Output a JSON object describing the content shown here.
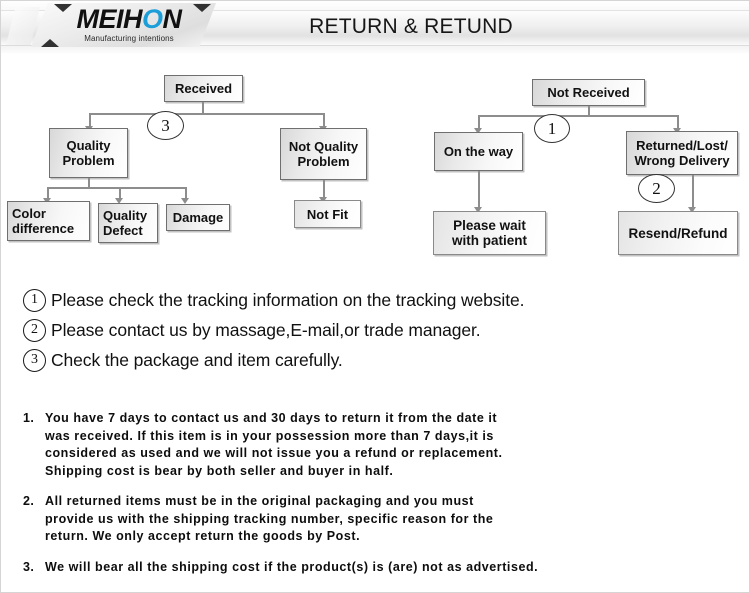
{
  "header": {
    "logo_text_main": "MEIH",
    "logo_text_accent": "O",
    "logo_text_tail": "N",
    "logo_tagline": "Manufacturing intentions",
    "title": "RETURN & RETUND",
    "accent_color": "#1c9fd8"
  },
  "flowchart_left": {
    "root": "Received",
    "branch_quality": "Quality\nProblem",
    "branch_quality_line1": "Quality",
    "branch_quality_line2": "Problem",
    "branch_not_quality_line1": "Not Quality",
    "branch_not_quality_line2": "Problem",
    "marker": "3",
    "leaf_color_line1": "Color",
    "leaf_color_line2": "difference",
    "leaf_defect_line1": "Quality",
    "leaf_defect_line2": "Defect",
    "leaf_damage": "Damage",
    "leaf_not_fit": "Not Fit"
  },
  "flowchart_right": {
    "root": "Not  Received",
    "marker_one": "1",
    "marker_two": "2",
    "branch_on_the_way": "On the way",
    "wait_line1": "Please wait",
    "wait_line2": "with patient",
    "branch_returned_line1": "Returned/Lost/",
    "branch_returned_line2": "Wrong Delivery",
    "resend_refund": "Resend/Refund"
  },
  "steps": [
    {
      "num": "1",
      "text": "Please check the tracking information on the tracking website."
    },
    {
      "num": "2",
      "text": "Please contact us by  massage,E-mail,or trade manager."
    },
    {
      "num": "3",
      "text": "Check the package and item carefully."
    }
  ],
  "policy": [
    {
      "num": "1.",
      "lines": [
        "You have 7 days to contact us and 30 days to return it from the date it",
        "was received. If this item is in your possession more than 7 days,it is",
        "considered as used and we will not issue you a refund or replacement.",
        "Shipping cost is bear by both seller and buyer in half."
      ]
    },
    {
      "num": "2.",
      "lines": [
        "All returned items must be in the original packaging and you must",
        "provide us with the shipping tracking number, specific reason for the",
        "return. We only accept return the goods by Post."
      ]
    },
    {
      "num": "3.",
      "lines": [
        "We will bear all the shipping cost if the product(s) is (are) not as advertised."
      ]
    }
  ]
}
